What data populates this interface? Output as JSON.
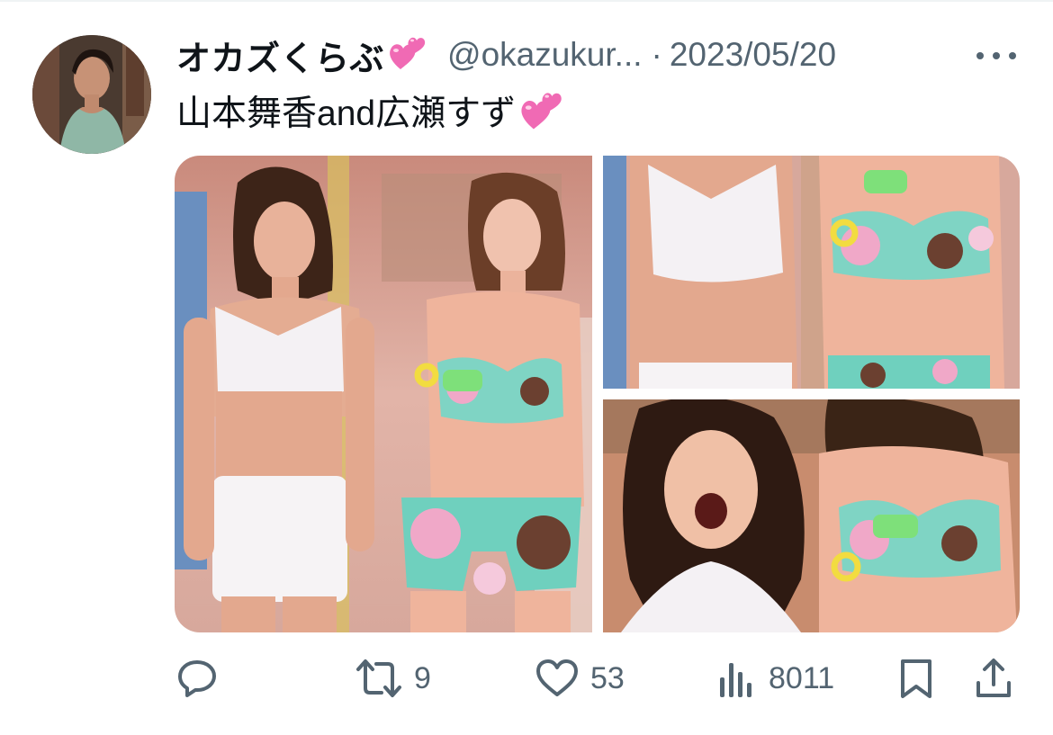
{
  "tweet": {
    "display_name": "オカズくらぶ",
    "handle": "@okazukur...",
    "separator": "·",
    "date": "2023/05/20",
    "text": "山本舞香and広瀬すず",
    "emoji_icon": "two-hearts-emoji",
    "media_count": 3
  },
  "actions": {
    "reply_count": "",
    "retweet_count": "9",
    "like_count": "53",
    "view_count": "8011"
  },
  "colors": {
    "text_primary": "#0f1419",
    "text_secondary": "#536471",
    "divider": "#eff3f4",
    "heart_emoji": "#f06ab4"
  },
  "icons": {
    "more": "more-horizontal-icon",
    "reply": "reply-icon",
    "retweet": "retweet-icon",
    "like": "heart-icon",
    "views": "views-chart-icon",
    "bookmark": "bookmark-icon",
    "share": "share-icon"
  }
}
